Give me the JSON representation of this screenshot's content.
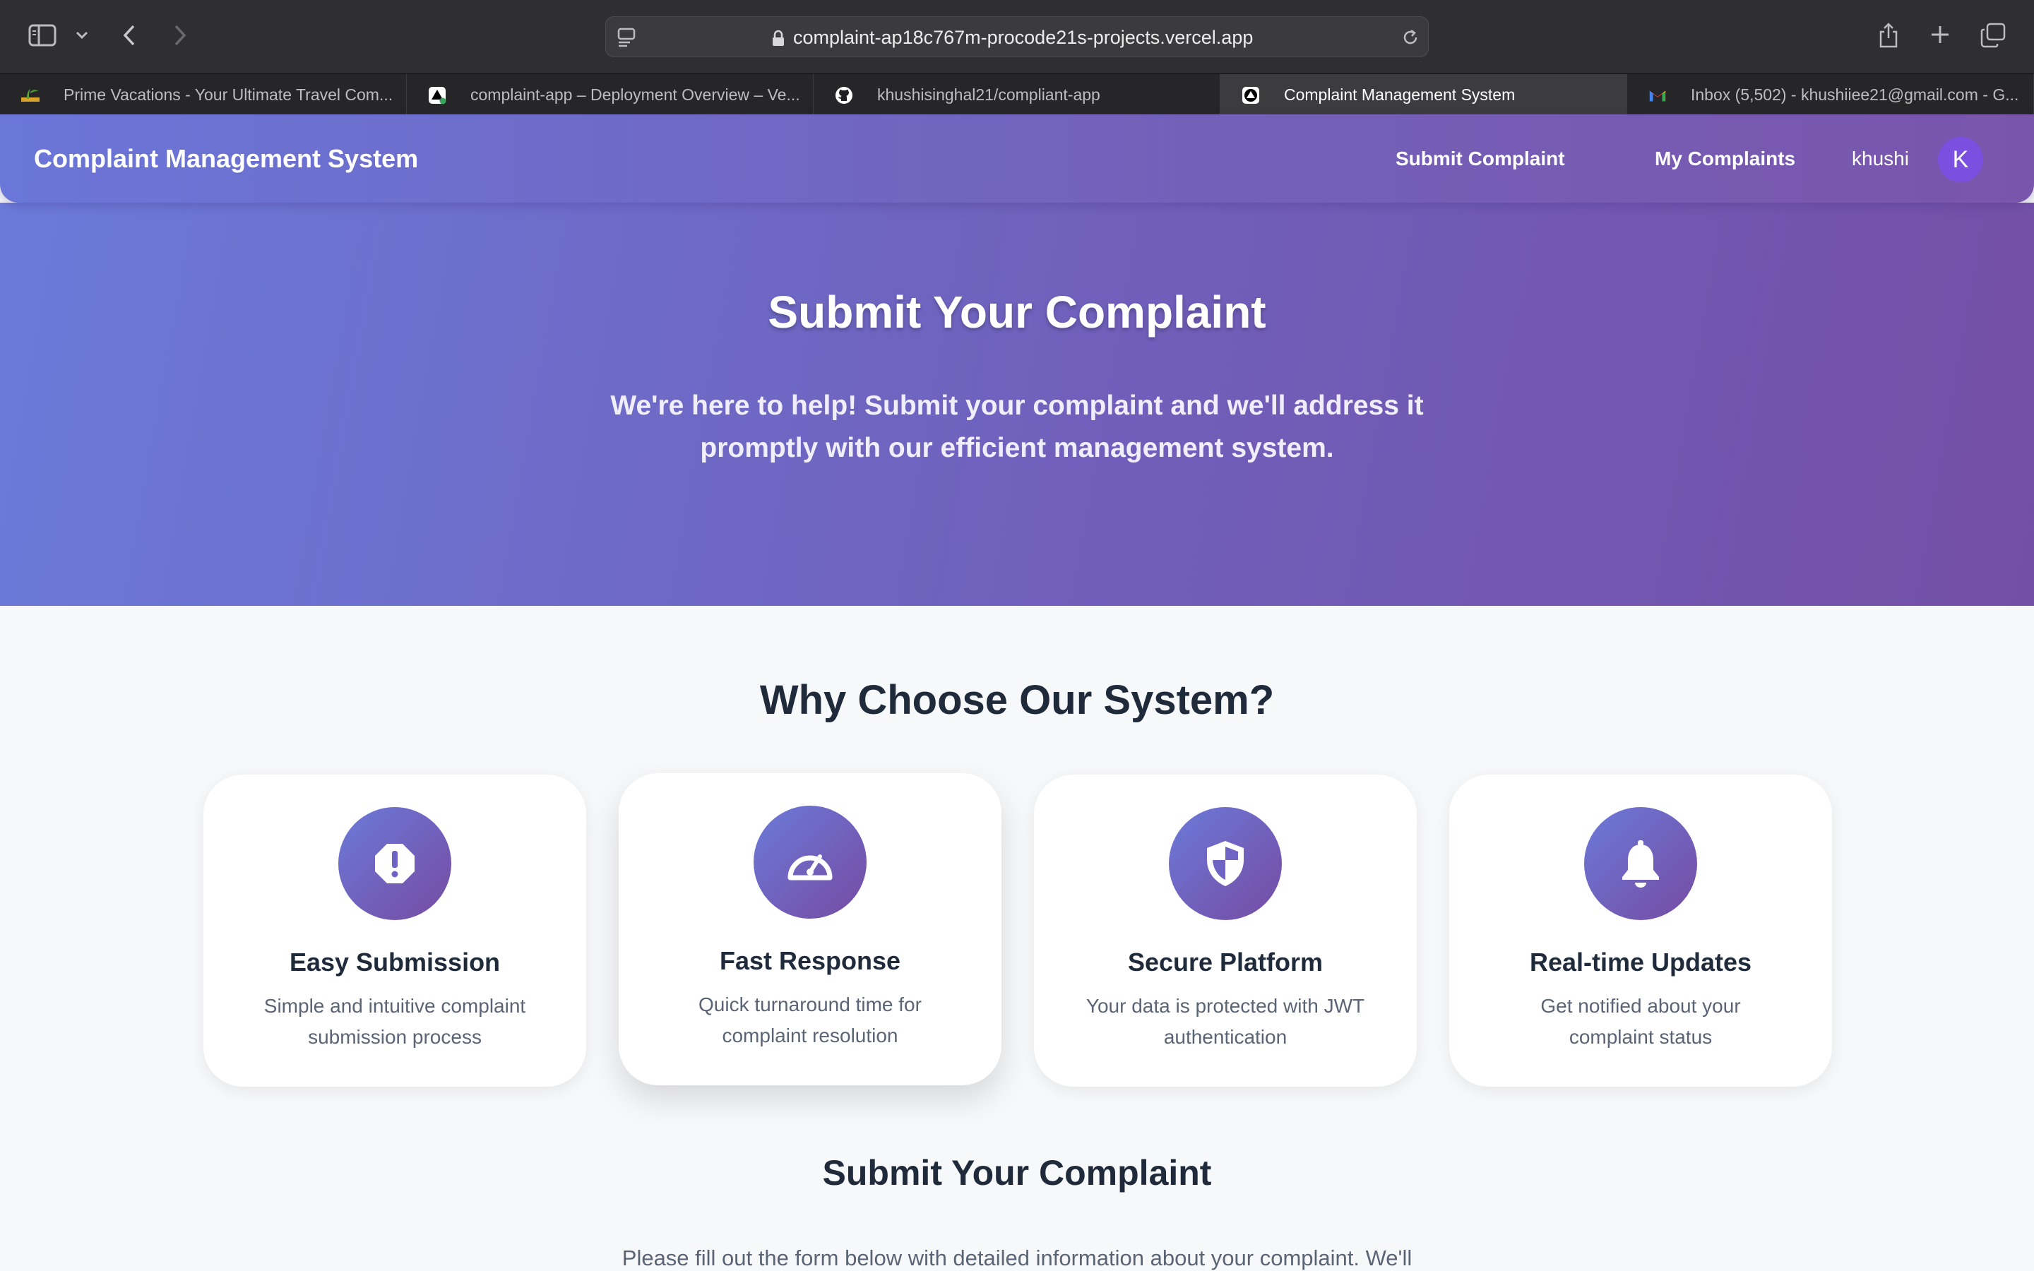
{
  "browser": {
    "url": "complaint-ap18c767m-procode21s-projects.vercel.app",
    "tabs": [
      {
        "label": "Prime Vacations - Your Ultimate Travel Com...",
        "icon": "palm-icon",
        "active": false
      },
      {
        "label": "complaint-app – Deployment Overview – Ve...",
        "icon": "vercel-icon",
        "active": false
      },
      {
        "label": "khushisinghal21/compliant-app",
        "icon": "github-icon",
        "active": false
      },
      {
        "label": "Complaint Management System",
        "icon": "vercel-icon",
        "active": true
      },
      {
        "label": "Inbox (5,502) - khushiiee21@gmail.com - G...",
        "icon": "gmail-icon",
        "active": false
      }
    ]
  },
  "nav": {
    "brand": "Complaint Management System",
    "links": [
      "Submit Complaint",
      "My Complaints"
    ],
    "username": "khushi",
    "avatar_initial": "K"
  },
  "hero": {
    "title": "Submit Your Complaint",
    "subtitle": "We're here to help! Submit your complaint and we'll address it promptly with our efficient management system."
  },
  "features": {
    "title": "Why Choose Our System?",
    "cards": [
      {
        "icon": "exclamation-octagon-icon",
        "title": "Easy Submission",
        "desc": "Simple and intuitive complaint submission process"
      },
      {
        "icon": "speedometer-icon",
        "title": "Fast Response",
        "desc": "Quick turnaround time for complaint resolution"
      },
      {
        "icon": "shield-icon",
        "title": "Secure Platform",
        "desc": "Your data is protected with JWT authentication"
      },
      {
        "icon": "bell-icon",
        "title": "Real-time Updates",
        "desc": "Get notified about your complaint status"
      }
    ]
  },
  "form_section": {
    "title": "Submit Your Complaint",
    "subtitle": "Please fill out the form below with detailed information about your complaint. We'll"
  },
  "colors": {
    "gradient_start": "#6b7ad9",
    "gradient_end": "#764ba2",
    "avatar": "#7b4fe0",
    "heading": "#1f2a3b"
  }
}
